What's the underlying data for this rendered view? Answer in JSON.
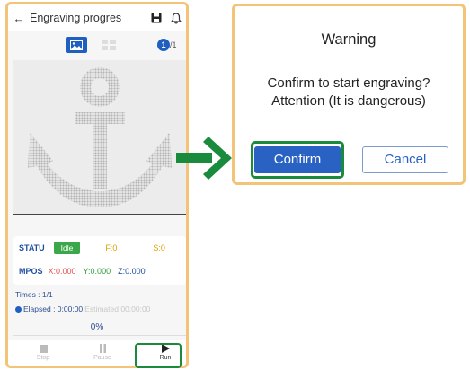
{
  "phone": {
    "header": {
      "title": "Engraving progres",
      "back_icon": "arrow-left-icon",
      "save_icon": "save-icon",
      "notify_icon": "bell-icon"
    },
    "view_toggle": {
      "image_icon": "image-icon",
      "grid_icon": "grid-icon"
    },
    "page": {
      "current": "1",
      "total": "/1"
    },
    "status": {
      "statu_label": "STATU",
      "state": "Idle",
      "feed": "F:0",
      "spindle": "S:0",
      "mpos_label": "MPOS",
      "x": "X:0.000",
      "y": "Y:0.000",
      "z": "Z:0.000"
    },
    "times": "Times : 1/1",
    "elapsed_label": "Elapsed : 0:00:00",
    "estimated_label": "Estimated 00:00:00",
    "progress_text": "0%",
    "progress": 0,
    "bottom": {
      "stop_label": "Stop",
      "pause_label": "Pause",
      "run_label": "Run"
    }
  },
  "dialog": {
    "title": "Warning",
    "message": "Confirm to start engraving? Attention (It is dangerous)",
    "confirm_label": "Confirm",
    "cancel_label": "Cancel"
  },
  "colors": {
    "accent_blue": "#2a62c4",
    "highlight_green": "#1a8a3c",
    "border_orange": "#f3c478",
    "idle_green": "#3aa84a"
  }
}
